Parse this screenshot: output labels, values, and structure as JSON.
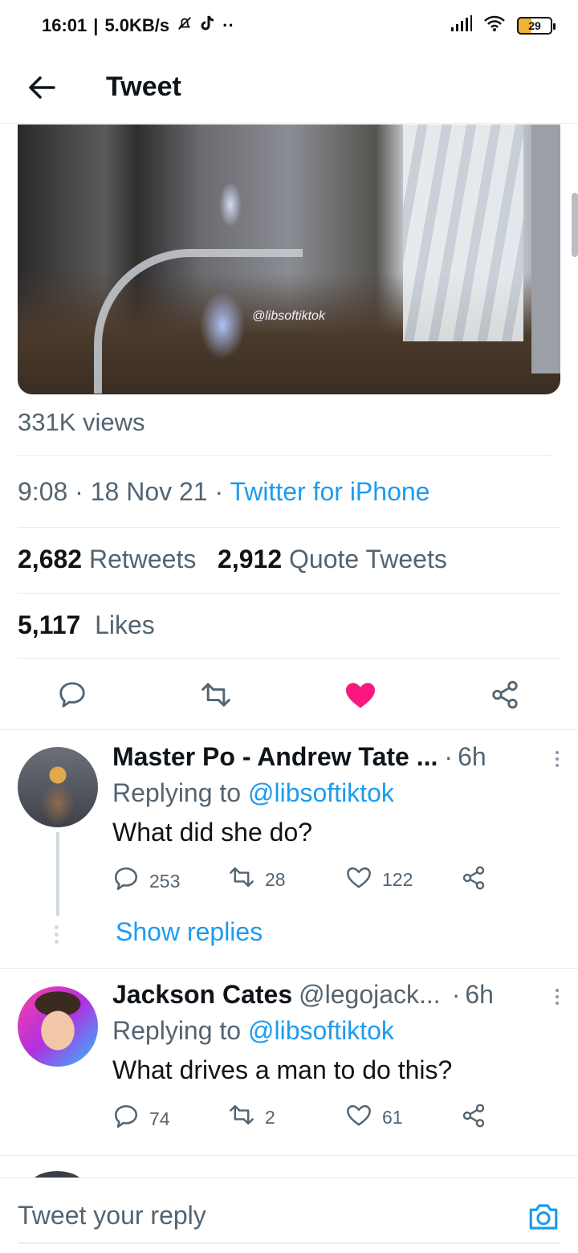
{
  "status_bar": {
    "time": "16:01",
    "speed": "5.0KB/s",
    "battery": "29"
  },
  "header": {
    "title": "Tweet"
  },
  "media": {
    "watermark": "@libsoftiktok"
  },
  "tweet": {
    "views": "331K views",
    "time": "9:08",
    "date": "18 Nov 21",
    "source": "Twitter for iPhone",
    "retweets_count": "2,682",
    "retweets_label": "Retweets",
    "quotes_count": "2,912",
    "quotes_label": "Quote Tweets",
    "likes_count": "5,117",
    "likes_label": "Likes",
    "liked": true
  },
  "replies": [
    {
      "name": "Master Po - Andrew Tate ...",
      "time": "6h",
      "replying_label": "Replying to",
      "mention": "@libsoftiktok",
      "text": "What did she do?",
      "reply_count": "253",
      "retweet_count": "28",
      "like_count": "122",
      "show_replies": "Show replies"
    },
    {
      "name": "Jackson Cates",
      "handle": "@legojack...",
      "time": "6h",
      "replying_label": "Replying to",
      "mention": "@libsoftiktok",
      "text": "What drives a man to do this?",
      "reply_count": "74",
      "retweet_count": "2",
      "like_count": "61"
    }
  ],
  "composer": {
    "placeholder": "Tweet your reply"
  },
  "colors": {
    "accent": "#1d9bf0",
    "like": "#f91880",
    "muted": "#536471"
  }
}
